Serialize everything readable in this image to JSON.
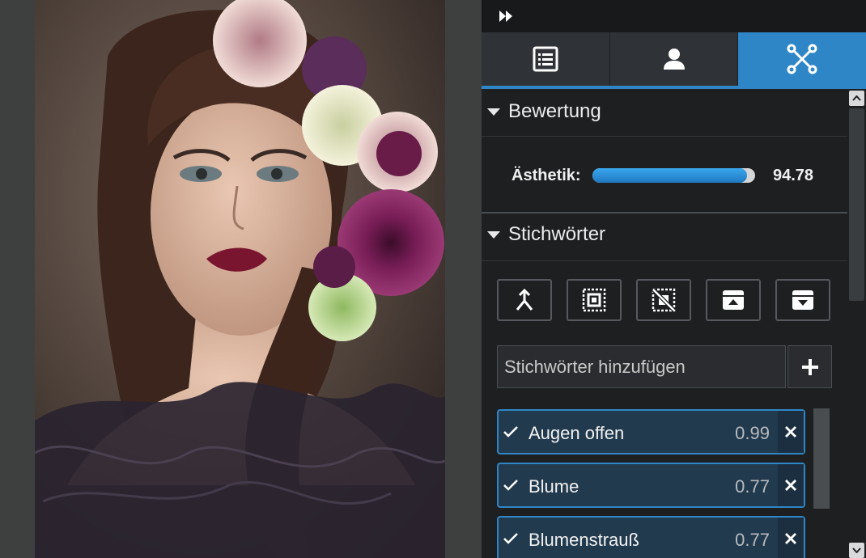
{
  "toolbar": {
    "expand_icon": "fast-forward-icon"
  },
  "tabs": [
    {
      "icon": "list-icon",
      "active": false
    },
    {
      "icon": "person-icon",
      "active": false
    },
    {
      "icon": "network-icon",
      "active": true
    }
  ],
  "rating": {
    "title": "Bewertung",
    "aesthetic_label": "Ästhetik:",
    "aesthetic_value": "94.78",
    "aesthetic_fraction": 0.9478
  },
  "keywords": {
    "title": "Stichwörter",
    "tools": [
      "merge-icon",
      "select-all-icon",
      "deselect-icon",
      "import-icon",
      "export-icon"
    ],
    "input_placeholder": "Stichwörter hinzufügen",
    "items": [
      {
        "label": "Augen offen",
        "score": "0.99"
      },
      {
        "label": "Blume",
        "score": "0.77"
      },
      {
        "label": "Blumenstrauß",
        "score": "0.77"
      }
    ]
  },
  "colors": {
    "accent": "#2f86c6",
    "panel_bg": "#1d1f21",
    "keyword_bg": "#223a4e"
  }
}
